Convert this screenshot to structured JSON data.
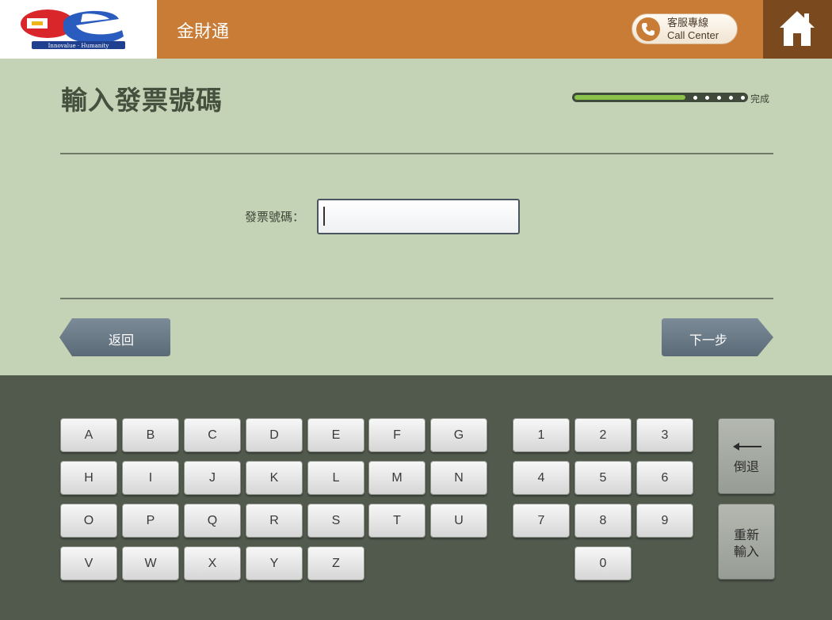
{
  "header": {
    "logo_text": "Innovalue · Humanity",
    "app_name": "金財通",
    "call_center": {
      "zh": "客服專線",
      "en": "Call Center"
    },
    "icons": [
      "logo-icon",
      "phone-icon",
      "home-icon"
    ]
  },
  "main": {
    "title": "輸入發票號碼",
    "progress": {
      "fraction": 0.65,
      "steps_remaining": 5,
      "label": "完成"
    },
    "invoice_label": "發票號碼：",
    "invoice_value": "",
    "back_label": "返回",
    "next_label": "下一步"
  },
  "keypad": {
    "letters": [
      "A",
      "B",
      "C",
      "D",
      "E",
      "F",
      "G",
      "H",
      "I",
      "J",
      "K",
      "L",
      "M",
      "N",
      "O",
      "P",
      "Q",
      "R",
      "S",
      "T",
      "U",
      "V",
      "W",
      "X",
      "Y",
      "Z"
    ],
    "digits": [
      "1",
      "2",
      "3",
      "4",
      "5",
      "6",
      "7",
      "8",
      "9",
      "0"
    ],
    "backspace_label": "倒退",
    "reset_label_line1": "重新",
    "reset_label_line2": "輸入"
  },
  "colors": {
    "header": "#c97c36",
    "home_button": "#7a4a1e",
    "panel": "#c4d3b6",
    "keypad_bg": "#525a4e",
    "progress_fill": "#8bc34a",
    "nav_button": "#667785"
  }
}
